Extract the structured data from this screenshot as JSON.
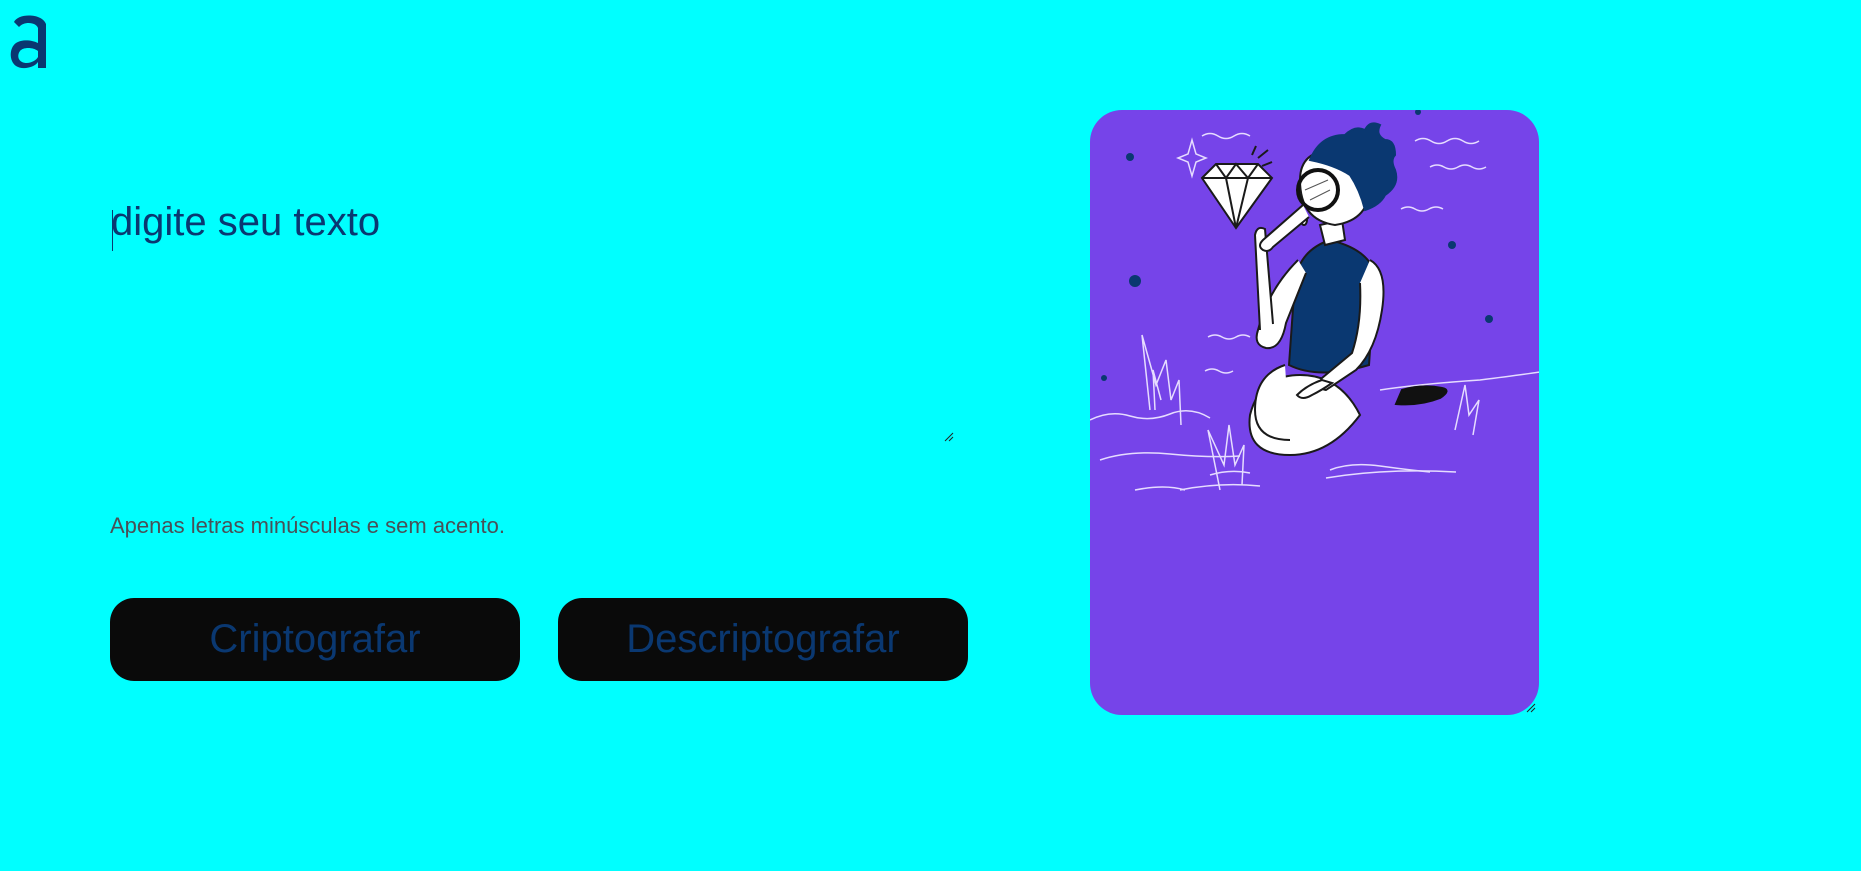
{
  "brand": {
    "logo_icon": "alura-a-logo-icon",
    "colors": {
      "background": "#00ffff",
      "text": "#0a3871",
      "button_bg": "#0a0a0a",
      "panel_bg": "#7644e9",
      "hint": "#495057"
    }
  },
  "input": {
    "placeholder": "digite seu texto",
    "value": ""
  },
  "hint": {
    "text": "Apenas letras minúsculas e sem acento."
  },
  "actions": {
    "encrypt_label": "Criptografar",
    "decrypt_label": "Descriptografar"
  },
  "output": {
    "illustration_icon": "person-with-magnifier-illustration-icon"
  }
}
